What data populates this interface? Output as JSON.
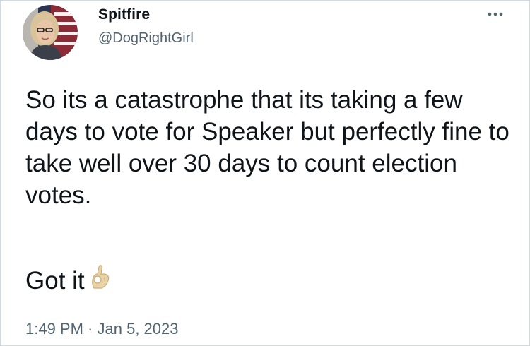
{
  "tweet": {
    "author": {
      "display_name": "Spitfire",
      "handle": "@DogRightGirl",
      "avatar_icon": "user-avatar-photo"
    },
    "more_icon": "more-options-icon",
    "text": "So its a catastrophe that its taking a few days to vote for Speaker but perfectly fine to take well over 30 days to count election votes.",
    "followup": "Got it",
    "emoji_icon": "ok-hand-emoji",
    "time": "1:49 PM",
    "separator": " · ",
    "date": "Jan 5, 2023"
  },
  "colors": {
    "text": "#0f1419",
    "secondary_text": "#536471",
    "border": "#cfd9de",
    "background": "#ffffff"
  }
}
